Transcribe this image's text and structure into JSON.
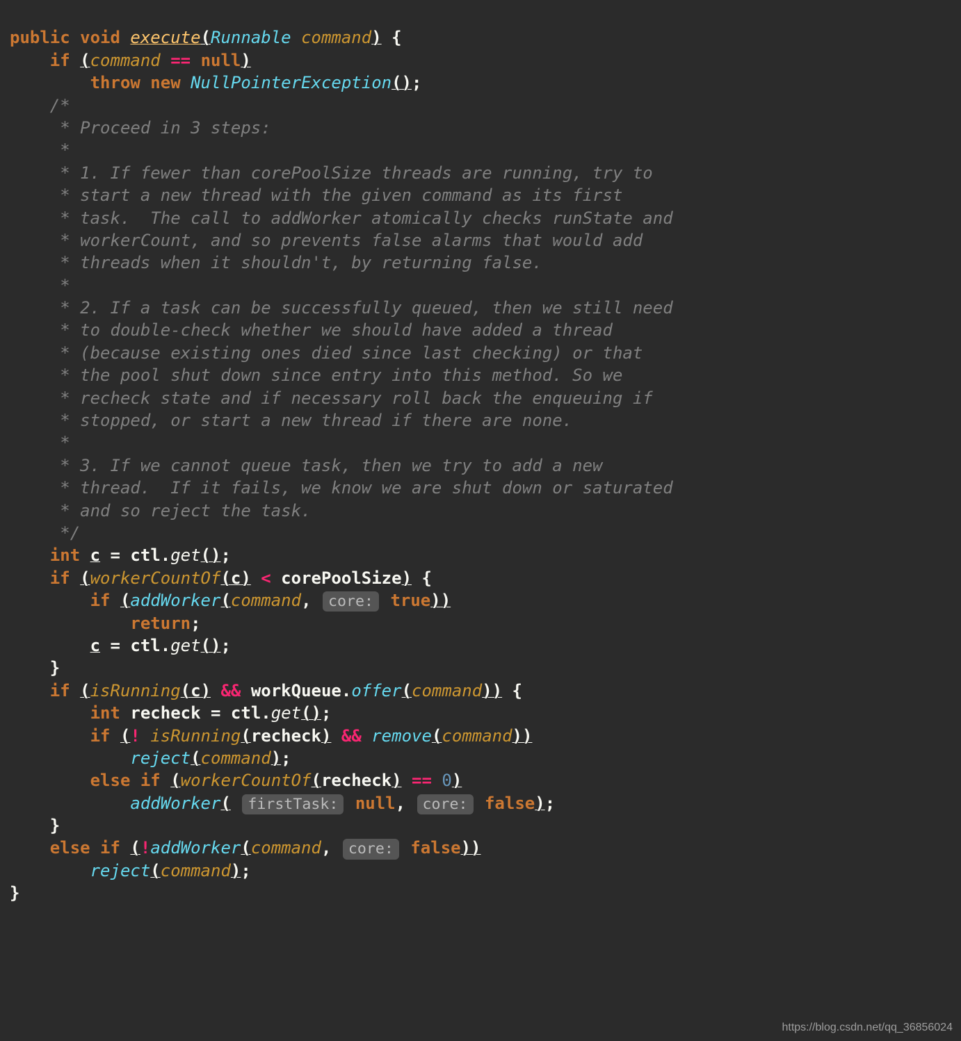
{
  "tokens": {
    "kw_public": "public",
    "kw_void": "void",
    "kw_if": "if",
    "kw_throw": "throw",
    "kw_new": "new",
    "kw_int": "int",
    "kw_return": "return",
    "kw_else": "else",
    "kw_elseif": "else if",
    "kw_null": "null",
    "kw_true": "true",
    "kw_false": "false",
    "name_execute": "execute",
    "type_Runnable": "Runnable",
    "type_NPE": "NullPointerException",
    "param_command": "command",
    "var_c": "c",
    "var_recheck": "recheck",
    "fld_ctl": "ctl",
    "fld_corePoolSize": "corePoolSize",
    "fld_workQueue": "workQueue",
    "call_get": "get",
    "call_workerCountOf": "workerCountOf",
    "call_addWorker": "addWorker",
    "call_isRunning": "isRunning",
    "call_offer": "offer",
    "call_remove": "remove",
    "call_reject": "reject",
    "hint_core": "core:",
    "hint_firstTask": "firstTask:",
    "zero": "0",
    "op_eqeq": "==",
    "op_lt": "<",
    "op_andand": "&&",
    "op_bang": "!",
    "p_open": "(",
    "p_close": ")",
    "brace_open": "{",
    "brace_close": "}",
    "comma": ",",
    "semi": ";",
    "dot": ".",
    "eq": "="
  },
  "comment_lines": {
    "l0": "/*",
    "l1": " * Proceed in 3 steps:",
    "l2": " *",
    "l3": " * 1. If fewer than corePoolSize threads are running, try to",
    "l4": " * start a new thread with the given command as its first",
    "l5": " * task.  The call to addWorker atomically checks runState and",
    "l6": " * workerCount, and so prevents false alarms that would add",
    "l7": " * threads when it shouldn't, by returning false.",
    "l8": " *",
    "l9": " * 2. If a task can be successfully queued, then we still need",
    "l10": " * to double-check whether we should have added a thread",
    "l11": " * (because existing ones died since last checking) or that",
    "l12": " * the pool shut down since entry into this method. So we",
    "l13": " * recheck state and if necessary roll back the enqueuing if",
    "l14": " * stopped, or start a new thread if there are none.",
    "l15": " *",
    "l16": " * 3. If we cannot queue task, then we try to add a new",
    "l17": " * thread.  If it fails, we know we are shut down or saturated",
    "l18": " * and so reject the task.",
    "l19": " */"
  },
  "watermark": "https://blog.csdn.net/qq_36856024"
}
